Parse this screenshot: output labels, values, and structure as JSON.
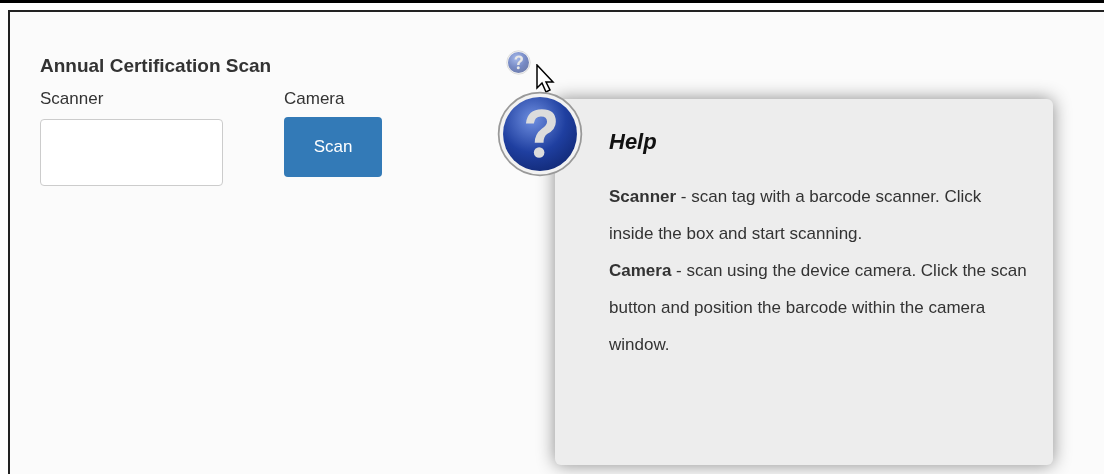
{
  "form": {
    "title": "Annual Certification Scan",
    "fields": [
      {
        "kind": "input",
        "label": "Scanner"
      },
      {
        "kind": "button",
        "label": "Camera",
        "button": "Scan"
      }
    ]
  },
  "help_popup": {
    "title": "Help",
    "paragraphs": [
      "**Scanner** - scan tag with a barcode scanner. Click inside the box and start scanning.",
      "**Camera** - scan using the device camera. Click the scan button and position the barcode within the camera window."
    ]
  }
}
